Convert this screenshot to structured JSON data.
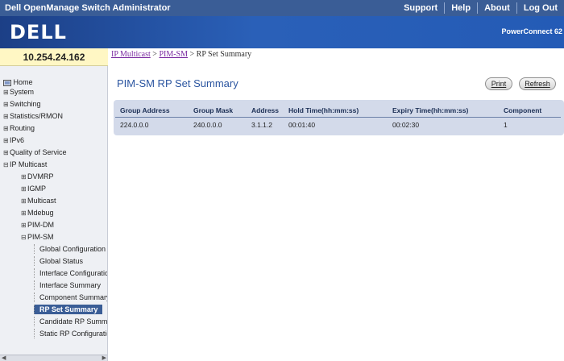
{
  "app": {
    "title": "Dell OpenManage Switch Administrator",
    "links": [
      "Support",
      "Help",
      "About",
      "Log Out"
    ],
    "logo": "DELL",
    "product": "PowerConnect 62"
  },
  "device_ip": "10.254.24.162",
  "nav": {
    "home": "Home",
    "system": "System",
    "switching": "Switching",
    "stats": "Statistics/RMON",
    "routing": "Routing",
    "ipv6": "IPv6",
    "qos": "Quality of Service",
    "ipmulticast": "IP Multicast",
    "dvmrp": "DVMRP",
    "igmp": "IGMP",
    "multicast": "Multicast",
    "mdebug": "Mdebug",
    "pimdm": "PIM-DM",
    "pimsm": "PIM-SM",
    "globalconfig": "Global Configuration",
    "globalstatus": "Global Status",
    "ifconfig": "Interface Configuration",
    "ifsummary": "Interface Summary",
    "compsummary": "Component Summary",
    "rpset": "RP Set Summary",
    "candrp": "Candidate RP Summary",
    "staticrp": "Static RP Configuration"
  },
  "breadcrumb": {
    "crumb1": "IP Multicast",
    "sep": " > ",
    "crumb2": "PIM-SM",
    "current": "RP Set Summary"
  },
  "page": {
    "title": "PIM-SM RP Set Summary",
    "print_label": "Print",
    "refresh_label": "Refresh"
  },
  "table": {
    "headers": [
      "Group Address",
      "Group Mask",
      "Address",
      "Hold Time(hh:mm:ss)",
      "Expiry Time(hh:mm:ss)",
      "Component"
    ],
    "rows": [
      [
        "224.0.0.0",
        "240.0.0.0",
        "3.1.1.2",
        "00:01:40",
        "00:02:30",
        "1"
      ]
    ]
  }
}
